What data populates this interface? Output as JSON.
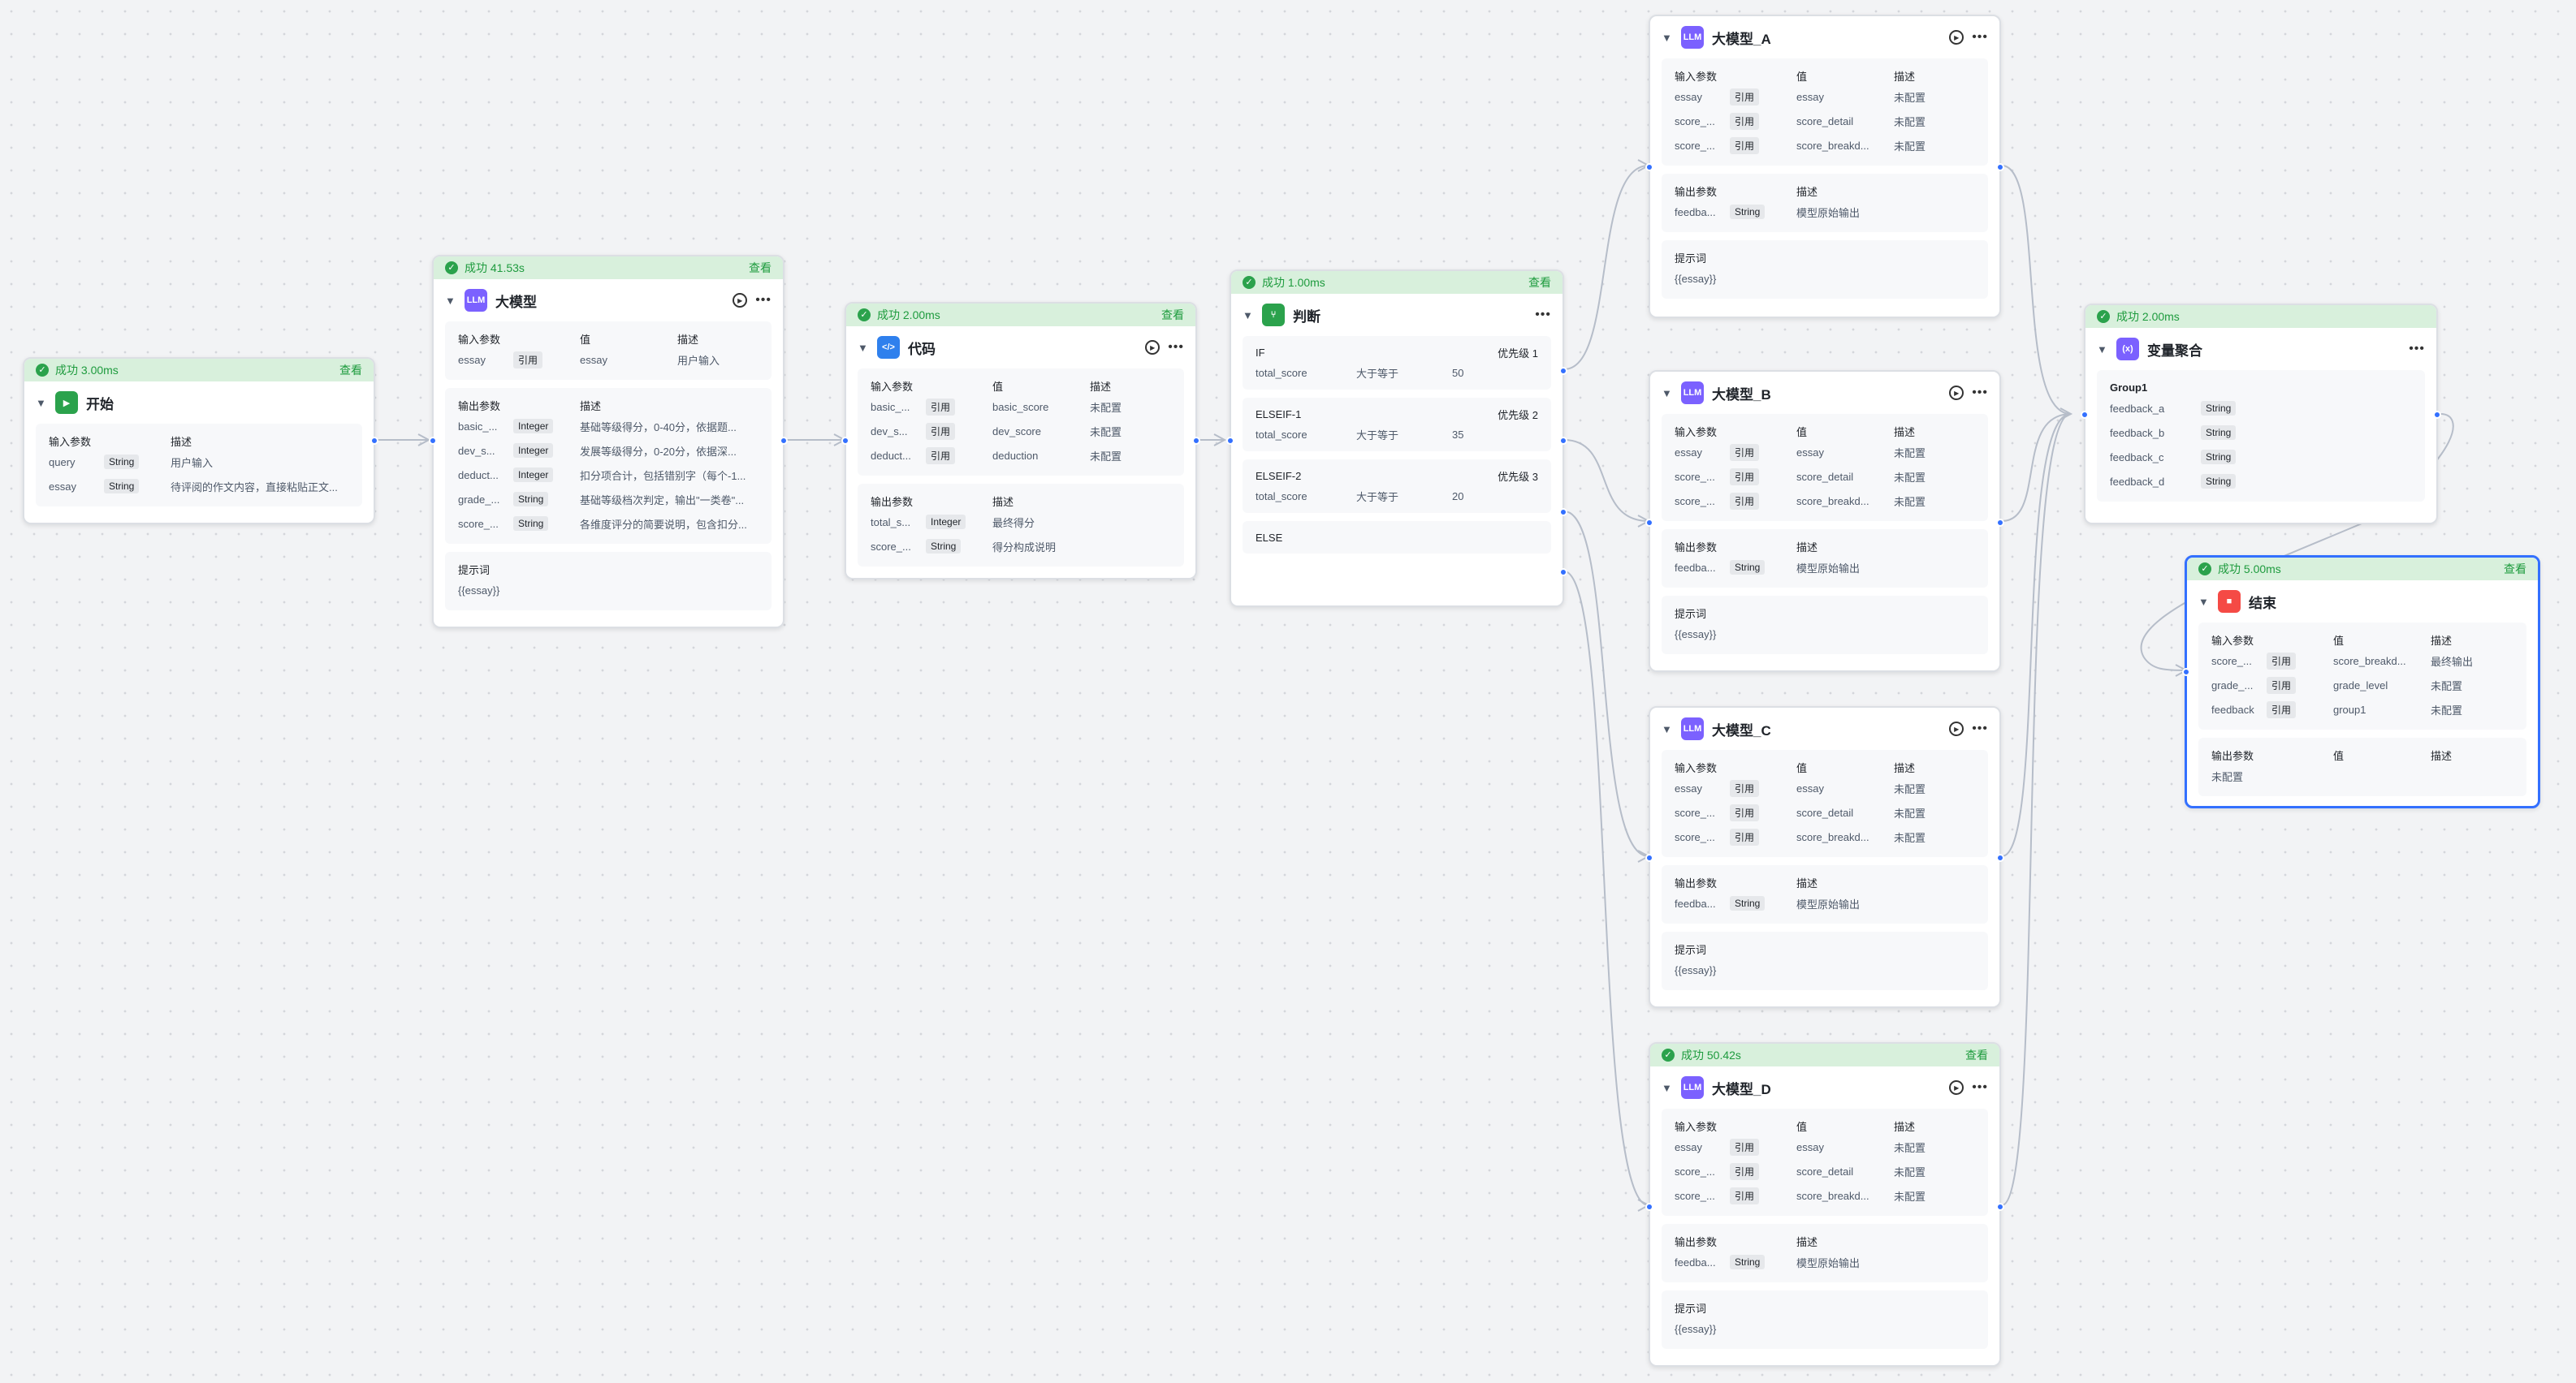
{
  "colors": {
    "accent": "#3370ff",
    "success": "#2ba24c",
    "edge": "#b6bdc9"
  },
  "view_label": "查看",
  "start": {
    "status": "成功 3.00ms",
    "title": "开始",
    "icon": "play-icon",
    "head": {
      "name": "输入参数",
      "desc": "描述"
    },
    "rows": [
      {
        "name": "query",
        "type": "String",
        "desc": "用户输入"
      },
      {
        "name": "essay",
        "type": "String",
        "desc": "待评阅的作文内容，直接粘贴正文..."
      }
    ]
  },
  "llm_main": {
    "status": "成功 41.53s",
    "title": "大模型",
    "icon": "llm-icon",
    "inputs_head": {
      "name": "输入参数",
      "value": "值",
      "desc": "描述"
    },
    "inputs": [
      {
        "name": "essay",
        "tag": "引用",
        "value": "essay",
        "desc": "用户输入"
      }
    ],
    "outputs_head": {
      "name": "输出参数",
      "desc": "描述"
    },
    "outputs": [
      {
        "name": "basic_...",
        "type": "Integer",
        "desc": "基础等级得分，0-40分，依据题..."
      },
      {
        "name": "dev_s...",
        "type": "Integer",
        "desc": "发展等级得分，0-20分，依据深..."
      },
      {
        "name": "deduct...",
        "type": "Integer",
        "desc": "扣分项合计，包括错别字（每个-1..."
      },
      {
        "name": "grade_...",
        "type": "String",
        "desc": "基础等级档次判定，输出\"一类卷\"..."
      },
      {
        "name": "score_...",
        "type": "String",
        "desc": "各维度评分的简要说明，包含扣分..."
      }
    ],
    "prompt_label": "提示词",
    "prompt": "{{essay}}"
  },
  "code": {
    "status": "成功 2.00ms",
    "title": "代码",
    "icon": "code-icon",
    "inputs_head": {
      "name": "输入参数",
      "value": "值",
      "desc": "描述"
    },
    "inputs": [
      {
        "name": "basic_...",
        "tag": "引用",
        "value": "basic_score",
        "desc": "未配置"
      },
      {
        "name": "dev_s...",
        "tag": "引用",
        "value": "dev_score",
        "desc": "未配置"
      },
      {
        "name": "deduct...",
        "tag": "引用",
        "value": "deduction",
        "desc": "未配置"
      }
    ],
    "outputs_head": {
      "name": "输出参数",
      "desc": "描述"
    },
    "outputs": [
      {
        "name": "total_s...",
        "type": "Integer",
        "desc": "最终得分"
      },
      {
        "name": "score_...",
        "type": "String",
        "desc": "得分构成说明"
      }
    ]
  },
  "judge": {
    "status": "成功 1.00ms",
    "title": "判断",
    "icon": "branch-icon",
    "branches": [
      {
        "label": "IF",
        "priority": "优先级 1",
        "var": "total_score",
        "op": "大于等于",
        "val": "50"
      },
      {
        "label": "ELSEIF-1",
        "priority": "优先级 2",
        "var": "total_score",
        "op": "大于等于",
        "val": "35"
      },
      {
        "label": "ELSEIF-2",
        "priority": "优先级 3",
        "var": "total_score",
        "op": "大于等于",
        "val": "20"
      }
    ],
    "else_label": "ELSE"
  },
  "llm_a": {
    "title": "大模型_A"
  },
  "llm_b": {
    "title": "大模型_B"
  },
  "llm_c": {
    "title": "大模型_C"
  },
  "llm_d": {
    "title": "大模型_D",
    "status": "成功 50.42s"
  },
  "llm_common": {
    "inputs_head": {
      "name": "输入参数",
      "value": "值",
      "desc": "描述"
    },
    "inputs": [
      {
        "name": "essay",
        "tag": "引用",
        "value": "essay",
        "desc": "未配置"
      },
      {
        "name": "score_...",
        "tag": "引用",
        "value": "score_detail",
        "desc": "未配置"
      },
      {
        "name": "score_...",
        "tag": "引用",
        "value": "score_breakd...",
        "desc": "未配置"
      }
    ],
    "outputs_head": {
      "name": "输出参数",
      "desc": "描述"
    },
    "outputs": [
      {
        "name": "feedba...",
        "type": "String",
        "desc": "模型原始输出"
      }
    ],
    "prompt_label": "提示词",
    "prompt": "{{essay}}"
  },
  "aggregate": {
    "status": "成功 2.00ms",
    "title": "变量聚合",
    "icon": "variable-icon",
    "group": "Group1",
    "rows": [
      {
        "name": "feedback_a",
        "type": "String"
      },
      {
        "name": "feedback_b",
        "type": "String"
      },
      {
        "name": "feedback_c",
        "type": "String"
      },
      {
        "name": "feedback_d",
        "type": "String"
      }
    ]
  },
  "end": {
    "status": "成功 5.00ms",
    "title": "结束",
    "icon": "stop-icon",
    "inputs_head": {
      "name": "输入参数",
      "value": "值",
      "desc": "描述"
    },
    "inputs": [
      {
        "name": "score_...",
        "tag": "引用",
        "value": "score_breakd...",
        "desc": "最终输出"
      },
      {
        "name": "grade_...",
        "tag": "引用",
        "value": "grade_level",
        "desc": "未配置"
      },
      {
        "name": "feedback",
        "tag": "引用",
        "value": "group1",
        "desc": "未配置"
      }
    ],
    "outputs_head": {
      "name": "输出参数",
      "value": "值",
      "desc": "描述"
    },
    "outputs_empty": "未配置"
  }
}
